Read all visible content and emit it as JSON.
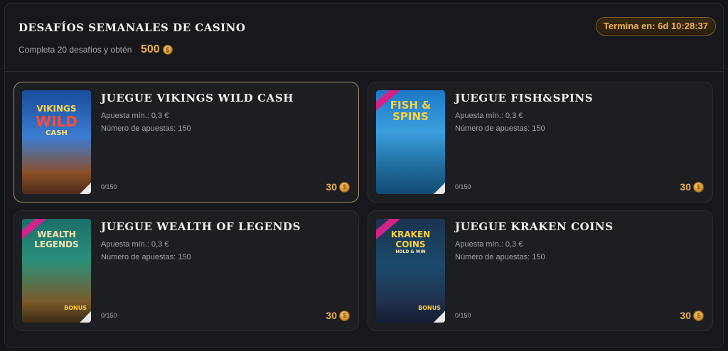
{
  "header": {
    "title": "Desafíos semanales de casino",
    "subtitle": "Completa 20 desafíos y obtén",
    "reward": "500",
    "timer": "Termina en: 6d 10:28:37"
  },
  "cards": [
    {
      "title": "Juegue Vikings Wild Cash",
      "min_bet": "Apuesta mín.: 0,3 €",
      "bets": "Número de apuestas: 150",
      "progress": "0/150",
      "points": "30",
      "thumb_text": [
        "VIKINGS",
        "WILD",
        "CASH"
      ]
    },
    {
      "title": "Juegue Fish&Spins",
      "min_bet": "Apuesta mín.: 0,3 €",
      "bets": "Número de apuestas: 150",
      "progress": "0/150",
      "points": "30",
      "thumb_text": [
        "FISH &",
        "SPINS"
      ]
    },
    {
      "title": "Juegue Wealth of Legends",
      "min_bet": "Apuesta mín.: 0,3 €",
      "bets": "Número de apuestas: 150",
      "progress": "0/150",
      "points": "30",
      "thumb_text": [
        "WEALTH",
        "LEGENDS",
        "BONUS"
      ]
    },
    {
      "title": "Juegue Kraken Coins",
      "min_bet": "Apuesta mín.: 0,3 €",
      "bets": "Número de apuestas: 150",
      "progress": "0/150",
      "points": "30",
      "thumb_text": [
        "KRAKEN",
        "COINS",
        "HOLD & WIN",
        "BONUS"
      ]
    }
  ],
  "colors": {
    "accent_gold": "#e8b04a",
    "active_border": "#a48b63",
    "card_bg": "#1d1e22"
  },
  "icons": {
    "coin": "coin-icon"
  }
}
